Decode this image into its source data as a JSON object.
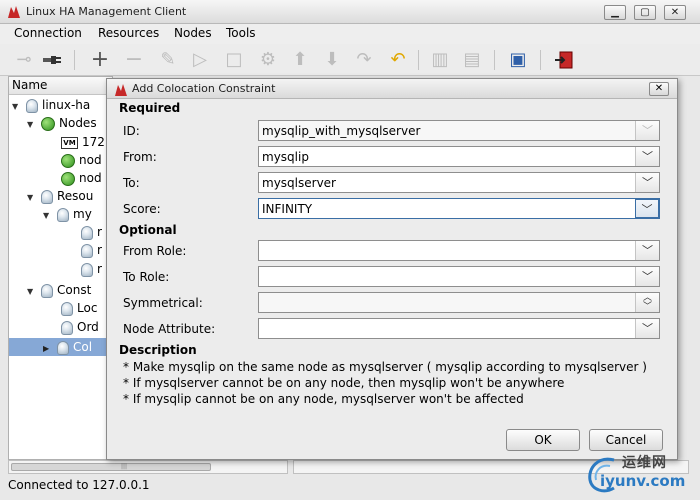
{
  "window": {
    "title": "Linux HA Management Client",
    "min": "▁",
    "max": "▢",
    "close": "✕"
  },
  "menu": [
    "Connection",
    "Resources",
    "Nodes",
    "Tools"
  ],
  "toolbar_icons": [
    "disconnect-icon",
    "connect-icon",
    "add-icon",
    "remove-icon",
    "cleanup-icon",
    "start-icon",
    "stop-icon",
    "settings-icon",
    "move-up-icon",
    "move-down-icon",
    "redo-icon",
    "undo-icon",
    "standby-icon",
    "active-icon",
    "view-icon",
    "exit-icon"
  ],
  "tree": {
    "header": "Name",
    "items": [
      {
        "label": "linux-ha"
      },
      {
        "label": "Nodes"
      },
      {
        "label": "172"
      },
      {
        "label": "nod"
      },
      {
        "label": "nod"
      },
      {
        "label": "Resou"
      },
      {
        "label": "my"
      },
      {
        "label": "r"
      },
      {
        "label": "r"
      },
      {
        "label": "r"
      },
      {
        "label": "Const"
      },
      {
        "label": "Loc"
      },
      {
        "label": "Ord"
      },
      {
        "label": "Col"
      }
    ]
  },
  "status": "Connected to 127.0.0.1",
  "dialog": {
    "title": "Add Colocation Constraint",
    "close": "✕",
    "required_label": "Required",
    "optional_label": "Optional",
    "description_label": "Description",
    "fields": {
      "id": {
        "label": "ID:",
        "value": "mysqlip_with_mysqlserver"
      },
      "from": {
        "label": "From:",
        "value": "mysqlip"
      },
      "to": {
        "label": "To:",
        "value": "mysqlserver"
      },
      "score": {
        "label": "Score:",
        "value": "INFINITY"
      },
      "from_role": {
        "label": "From Role:",
        "value": ""
      },
      "to_role": {
        "label": "To Role:",
        "value": ""
      },
      "symmetrical": {
        "label": "Symmetrical:",
        "value": ""
      },
      "node_attribute": {
        "label": "Node Attribute:",
        "value": ""
      }
    },
    "description_lines": [
      "* Make mysqlip  on the same node as mysqlserver   ( mysqlip according to mysqlserver )",
      "* If mysqlserver cannot be  on any node, then mysqlip won't be  anywhere",
      "* If mysqlip cannot be  on any node, mysqlserver won't be affected"
    ],
    "ok": "OK",
    "cancel": "Cancel"
  },
  "watermark": {
    "cn": "运维网",
    "url": "iyunv.com"
  }
}
